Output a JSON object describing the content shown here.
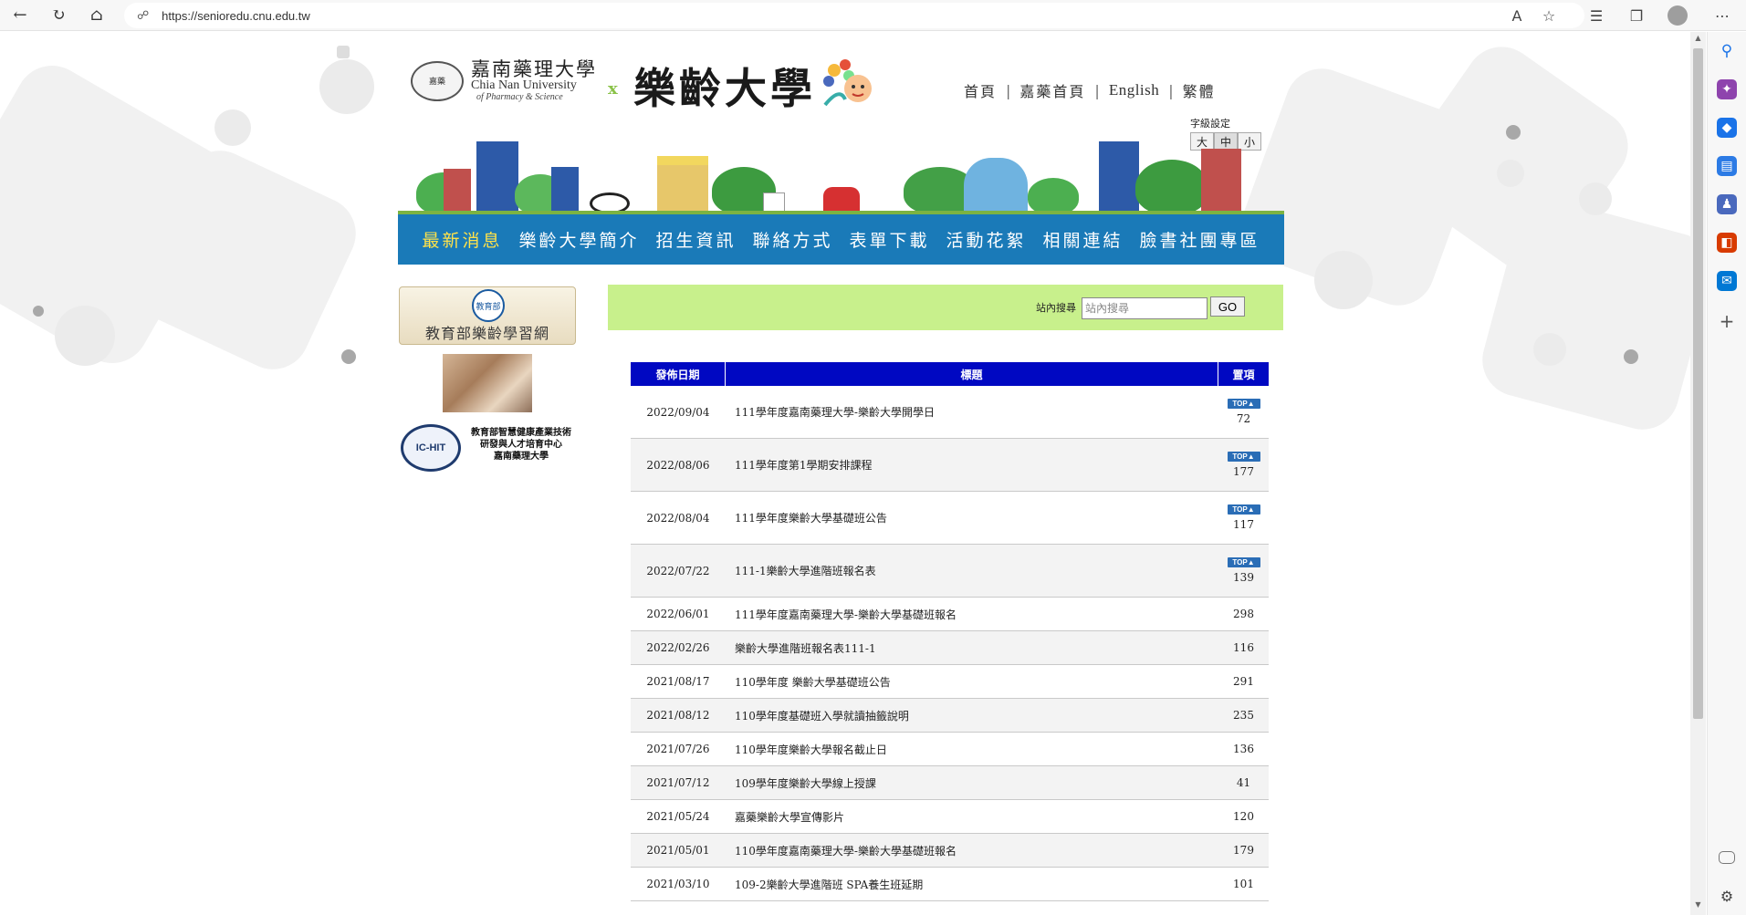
{
  "browser": {
    "url": "https://senioredu.cnu.edu.tw",
    "back_icon": "←",
    "refresh_icon": "↻",
    "home_icon": "⌂",
    "lock_icon": "🔒"
  },
  "header": {
    "cnu_zh": "嘉南藥理大學",
    "cnu_en": "Chia Nan University",
    "cnu_en2": "of Pharmacy & Science",
    "seal_text": "嘉藥",
    "x_mark": "x",
    "senior_title": "樂齡大學",
    "top_links": {
      "home": "首頁",
      "cnu_home": "嘉藥首頁",
      "english": "English",
      "traditional": "繁體"
    },
    "fontsize": {
      "label": "字級設定",
      "large": "大",
      "medium": "中",
      "small": "小"
    }
  },
  "mainnav": [
    "最新消息",
    "樂齡大學簡介",
    "招生資訊",
    "聯絡方式",
    "表單下載",
    "活動花絮",
    "相關連結",
    "臉書社團專區"
  ],
  "sidebar": {
    "moe_text": "教育部樂齡學習網",
    "moe_emblem": "教育部",
    "ichit_badge": "IC-HIT",
    "ichit_text": [
      "教育部智慧健康產業技術",
      "研發與人才培育中心",
      "嘉南藥理大學"
    ]
  },
  "search": {
    "label": "站內搜尋",
    "placeholder": "站內搜尋",
    "go_label": "GO"
  },
  "news": {
    "headers": {
      "date": "發佈日期",
      "title": "標題",
      "top": "置項"
    },
    "top_badge": "TOP▲",
    "rows": [
      {
        "date": "2022/09/04",
        "title": "111學年度嘉南藥理大學-樂齡大學開學日",
        "count": "72",
        "pinned": true
      },
      {
        "date": "2022/08/06",
        "title": "111學年度第1學期安排課程",
        "count": "177",
        "pinned": true
      },
      {
        "date": "2022/08/04",
        "title": "111學年度樂齡大學基礎班公告",
        "count": "117",
        "pinned": true
      },
      {
        "date": "2022/07/22",
        "title": "111-1樂齡大學進階班報名表",
        "count": "139",
        "pinned": true
      },
      {
        "date": "2022/06/01",
        "title": "111學年度嘉南藥理大學-樂齡大學基礎班報名",
        "count": "298",
        "pinned": false
      },
      {
        "date": "2022/02/26",
        "title": "樂齡大學進階班報名表111-1",
        "count": "116",
        "pinned": false
      },
      {
        "date": "2021/08/17",
        "title": "110學年度 樂齡大學基礎班公告",
        "count": "291",
        "pinned": false
      },
      {
        "date": "2021/08/12",
        "title": "110學年度基礎班入學就讀抽籤說明",
        "count": "235",
        "pinned": false
      },
      {
        "date": "2021/07/26",
        "title": "110學年度樂齡大學報名截止日",
        "count": "136",
        "pinned": false
      },
      {
        "date": "2021/07/12",
        "title": "109學年度樂齡大學線上授課",
        "count": "41",
        "pinned": false
      },
      {
        "date": "2021/05/24",
        "title": "嘉藥樂齡大學宣傳影片",
        "count": "120",
        "pinned": false
      },
      {
        "date": "2021/05/01",
        "title": "110學年度嘉南藥理大學-樂齡大學基礎班報名",
        "count": "179",
        "pinned": false
      },
      {
        "date": "2021/03/10",
        "title": "109-2樂齡大學進階班 SPA養生班延期",
        "count": "101",
        "pinned": false
      }
    ]
  }
}
